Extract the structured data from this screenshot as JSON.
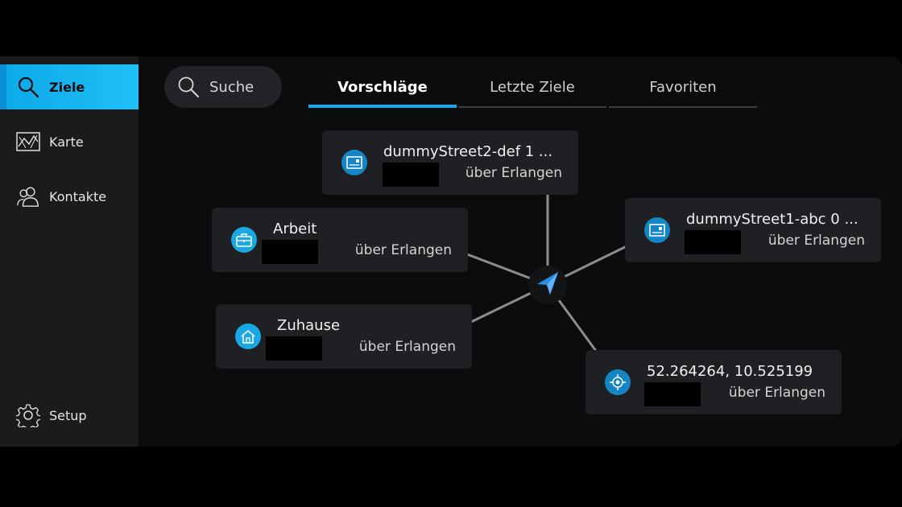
{
  "sidebar": {
    "items": [
      {
        "label": "Ziele",
        "icon": "search-icon",
        "active": true
      },
      {
        "label": "Karte",
        "icon": "map-icon",
        "active": false
      },
      {
        "label": "Kontakte",
        "icon": "contacts-icon",
        "active": false
      }
    ],
    "setup": {
      "label": "Setup",
      "icon": "gear-icon"
    }
  },
  "search": {
    "label": "Suche",
    "icon": "search-icon"
  },
  "tabs": [
    {
      "label": "Vorschläge",
      "active": true
    },
    {
      "label": "Letzte Ziele",
      "active": false
    },
    {
      "label": "Favoriten",
      "active": false
    }
  ],
  "destinations": [
    {
      "id": "street2",
      "title": "dummyStreet2-def 1 ...",
      "subtitle": "über Erlangen",
      "icon": "address-card-icon"
    },
    {
      "id": "street1",
      "title": "dummyStreet1-abc 0 ...",
      "subtitle": "über Erlangen",
      "icon": "address-card-icon"
    },
    {
      "id": "work",
      "title": "Arbeit",
      "subtitle": "über Erlangen",
      "icon": "briefcase-icon"
    },
    {
      "id": "home",
      "title": "Zuhause",
      "subtitle": "über Erlangen",
      "icon": "home-icon"
    },
    {
      "id": "coords",
      "title": "52.264264, 10.525199",
      "subtitle": "über Erlangen",
      "icon": "crosshair-icon"
    }
  ],
  "current_position": {
    "icon": "navigation-arrow-icon"
  },
  "colors": {
    "accent": "#1da8e6",
    "background": "#0b0c0e",
    "card": "#1f2023",
    "sidebar": "#1a1b1d"
  }
}
